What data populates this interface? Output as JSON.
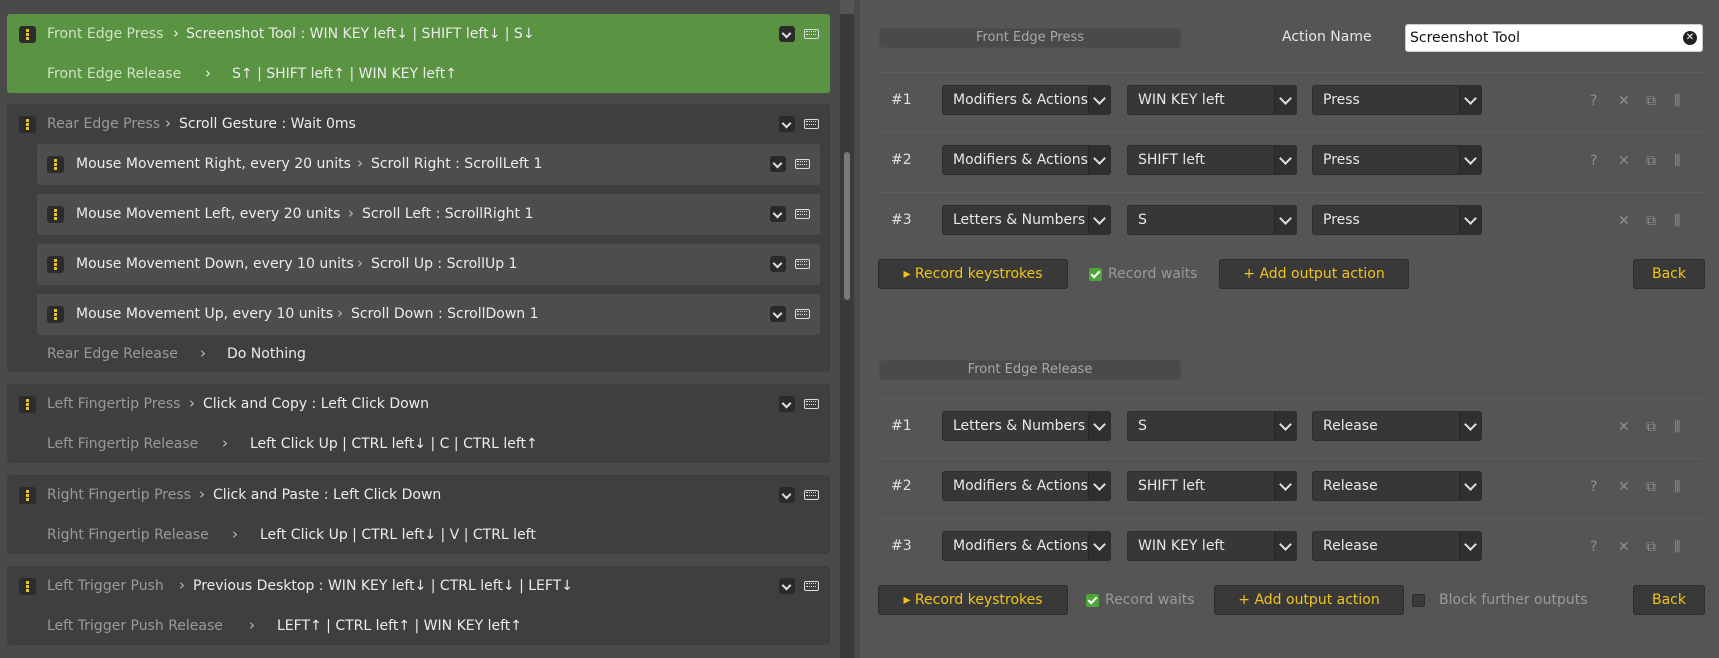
{
  "left": {
    "groups": [
      {
        "press_label": "Front Edge Press",
        "press_action": "Screenshot Tool : WIN KEY left↓ | SHIFT left↓ | S↓",
        "release_label": "Front Edge Release",
        "release_action": "S↑ | SHIFT left↑ | WIN KEY left↑",
        "active": true
      },
      {
        "press_label": "Rear Edge Press",
        "press_action": "Scroll Gesture : Wait 0ms",
        "sub": [
          {
            "label": "Mouse Movement Right, every 20 units",
            "action": "Scroll Right : ScrollLeft 1"
          },
          {
            "label": "Mouse Movement Left, every 20 units",
            "action": "Scroll Left : ScrollRight 1"
          },
          {
            "label": "Mouse Movement Down, every 10 units",
            "action": "Scroll Up : ScrollUp 1"
          },
          {
            "label": "Mouse Movement Up, every 10 units",
            "action": "Scroll Down : ScrollDown 1"
          }
        ],
        "release_label": "Rear Edge Release",
        "release_action": "Do Nothing"
      },
      {
        "press_label": "Left Fingertip Press",
        "press_action": "Click and Copy : Left Click Down",
        "release_label": "Left Fingertip Release",
        "release_action": "Left Click Up | CTRL left↓ | C | CTRL left↑"
      },
      {
        "press_label": "Right Fingertip Press",
        "press_action": "Click and Paste : Left Click Down",
        "release_label": "Right Fingertip Release",
        "release_action": "Left Click Up | CTRL left↓ | V | CTRL left"
      },
      {
        "press_label": "Left Trigger Push",
        "press_action": "Previous Desktop : WIN KEY left↓ | CTRL left↓ | LEFT↓",
        "release_label": "Left Trigger Push Release",
        "release_action": "LEFT↑ | CTRL left↑ | WIN KEY left↑"
      }
    ]
  },
  "right": {
    "action_name_label": "Action Name",
    "action_name_value": "Screenshot Tool",
    "sections": [
      {
        "header": "Front Edge Press",
        "rows": [
          {
            "num": "#1",
            "category": "Modifiers & Actions",
            "key": "WIN KEY left",
            "mode": "Press"
          },
          {
            "num": "#2",
            "category": "Modifiers & Actions",
            "key": "SHIFT left",
            "mode": "Press"
          },
          {
            "num": "#3",
            "category": "Letters & Numbers",
            "key": "S",
            "mode": "Press"
          }
        ],
        "record_label": "▸ Record keystrokes",
        "record_waits_label": "Record waits",
        "add_label": "+ Add output action",
        "back_label": "Back"
      },
      {
        "header": "Front Edge Release",
        "rows": [
          {
            "num": "#1",
            "category": "Letters & Numbers",
            "key": "S",
            "mode": "Release"
          },
          {
            "num": "#2",
            "category": "Modifiers & Actions",
            "key": "SHIFT left",
            "mode": "Release"
          },
          {
            "num": "#3",
            "category": "Modifiers & Actions",
            "key": "WIN KEY left",
            "mode": "Release"
          }
        ],
        "record_label": "▸ Record keystrokes",
        "record_waits_label": "Record waits",
        "add_label": "+ Add output action",
        "block_label": "Block further outputs",
        "back_label": "Back"
      }
    ],
    "icons": {
      "help": "?",
      "delete": "✕",
      "copy": "⧉",
      "drag": "⫼"
    }
  }
}
